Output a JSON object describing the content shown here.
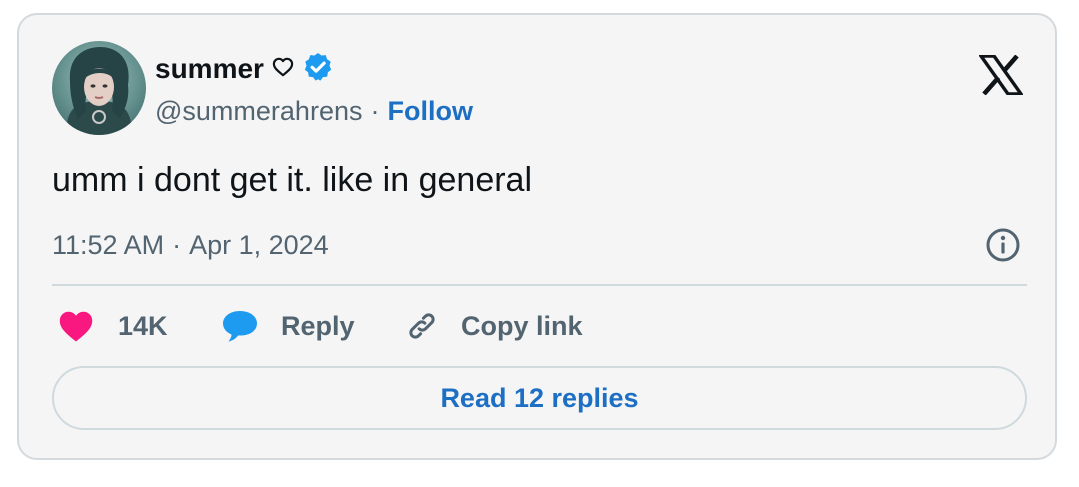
{
  "author": {
    "display_name": "summer",
    "name_emoji": "♡",
    "verified": true,
    "handle": "@summerahrens",
    "separator": "·",
    "follow_label": "Follow"
  },
  "tweet": {
    "text": "umm i dont get it. like in general",
    "time": "11:52 AM",
    "date": "Apr 1, 2024",
    "separator": "·"
  },
  "actions": {
    "like_count": "14K",
    "reply_label": "Reply",
    "copy_link_label": "Copy link"
  },
  "read_replies_label": "Read 12 replies",
  "colors": {
    "accent": "#1d6fc4",
    "like": "#f91880",
    "reply_bubble": "#1d9bf0",
    "verified": "#1d9bf0",
    "text_primary": "#0f1419",
    "text_secondary": "#536471"
  },
  "icons": {
    "brand": "x-logo-icon",
    "verified": "verified-badge-icon",
    "info": "info-icon",
    "like": "heart-icon",
    "reply": "speech-bubble-icon",
    "copy": "link-icon"
  }
}
